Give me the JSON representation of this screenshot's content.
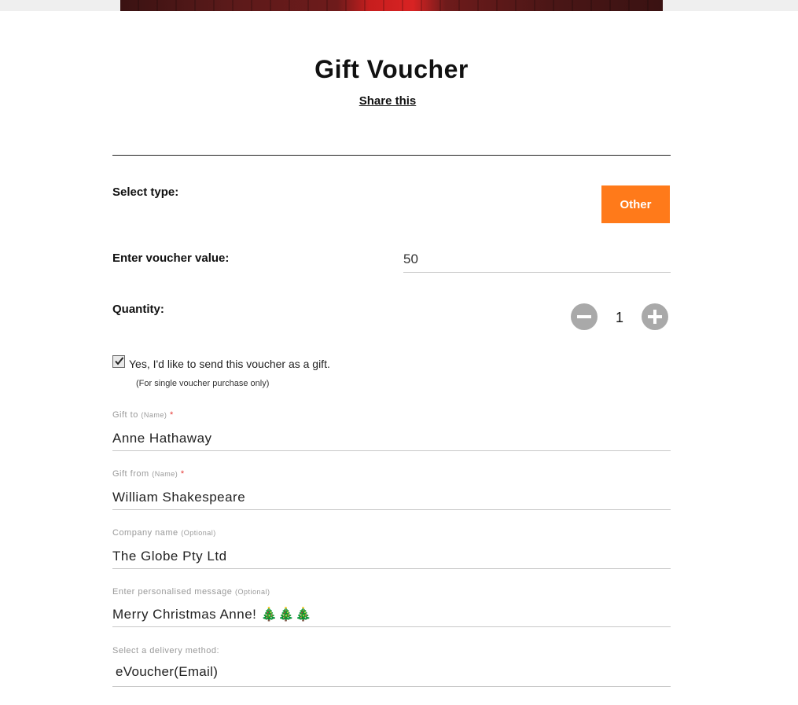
{
  "page": {
    "title": "Gift Voucher",
    "share_label": "Share this"
  },
  "type_select": {
    "label": "Select type:",
    "option_label": "Other"
  },
  "voucher_value": {
    "label": "Enter voucher value:",
    "value": "50"
  },
  "quantity": {
    "label": "Quantity:",
    "value": "1",
    "decrement_icon": "minus-icon",
    "increment_icon": "plus-icon"
  },
  "gift_option": {
    "checked": true,
    "label": "Yes, I'd like to send this voucher as a gift.",
    "note": "(For single voucher purchase only)"
  },
  "gift_to": {
    "label": "Gift to",
    "hint": "(Name)",
    "required_mark": "*",
    "value": "Anne Hathaway"
  },
  "gift_from": {
    "label": "Gift from",
    "hint": "(Name)",
    "required_mark": "*",
    "value": "William Shakespeare"
  },
  "company": {
    "label": "Company name",
    "hint": "(Optional)",
    "value": "The Globe Pty Ltd"
  },
  "message": {
    "label": "Enter personalised message",
    "hint": "(Optional)",
    "value": "Merry Christmas Anne! 🎄🎄🎄"
  },
  "delivery": {
    "label": "Select a delivery method:",
    "value": "eVoucher(Email)"
  },
  "colors": {
    "accent": "#ff7a1a",
    "required": "#e53935",
    "qty_button": "#a9a9a9"
  }
}
